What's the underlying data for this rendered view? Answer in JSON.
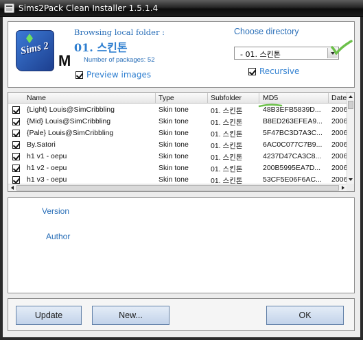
{
  "window": {
    "title": "Sims2Pack Clean Installer 1.5.1.4"
  },
  "header": {
    "browse_label": "Browsing local folder :",
    "folder_name": "01. 스킨톤",
    "num_packages": "Number of packages: 52",
    "logo_text": "Sims 2",
    "logo_overflow": "M",
    "preview_images": {
      "label": "Preview images",
      "checked": true
    },
    "choose_directory": "Choose directory",
    "directory_selected": "- 01. 스킨톤",
    "recursive": {
      "label": "Recursive",
      "checked": true
    }
  },
  "table": {
    "columns": [
      "Name",
      "Type",
      "Subfolder",
      "MD5",
      "Date"
    ],
    "rows": [
      {
        "checked": true,
        "name": "{Light} Louis@SimCribbling",
        "type": "Skin tone",
        "subfolder": "01. 스킨톤",
        "md5": "48B3EFB5839D...",
        "date": "2006"
      },
      {
        "checked": true,
        "name": "{Mid} Louis@SimCribbling",
        "type": "Skin tone",
        "subfolder": "01. 스킨톤",
        "md5": "B8ED263EFEA9...",
        "date": "2006"
      },
      {
        "checked": true,
        "name": "{Pale} Louis@SimCribbling",
        "type": "Skin tone",
        "subfolder": "01. 스킨톤",
        "md5": "5F47BC3D7A3C...",
        "date": "2006"
      },
      {
        "checked": true,
        "name": "By.Satori",
        "type": "Skin tone",
        "subfolder": "01. 스킨톤",
        "md5": "6AC0C077C7B9...",
        "date": "2006"
      },
      {
        "checked": true,
        "name": "h1 v1 - oepu",
        "type": "Skin tone",
        "subfolder": "01. 스킨톤",
        "md5": "4237D47CA3C8...",
        "date": "2006"
      },
      {
        "checked": true,
        "name": "h1 v2 - oepu",
        "type": "Skin tone",
        "subfolder": "01. 스킨톤",
        "md5": "200B5995EA7D...",
        "date": "2006"
      },
      {
        "checked": true,
        "name": "h1 v3 - oepu",
        "type": "Skin tone",
        "subfolder": "01. 스킨톤",
        "md5": "53CF5E06F6AC...",
        "date": "2006"
      }
    ]
  },
  "details": {
    "version_label": "Version",
    "author_label": "Author"
  },
  "buttons": {
    "update": "Update",
    "new": "New...",
    "ok": "OK"
  },
  "annotations": {
    "color": "#6cc04a"
  }
}
